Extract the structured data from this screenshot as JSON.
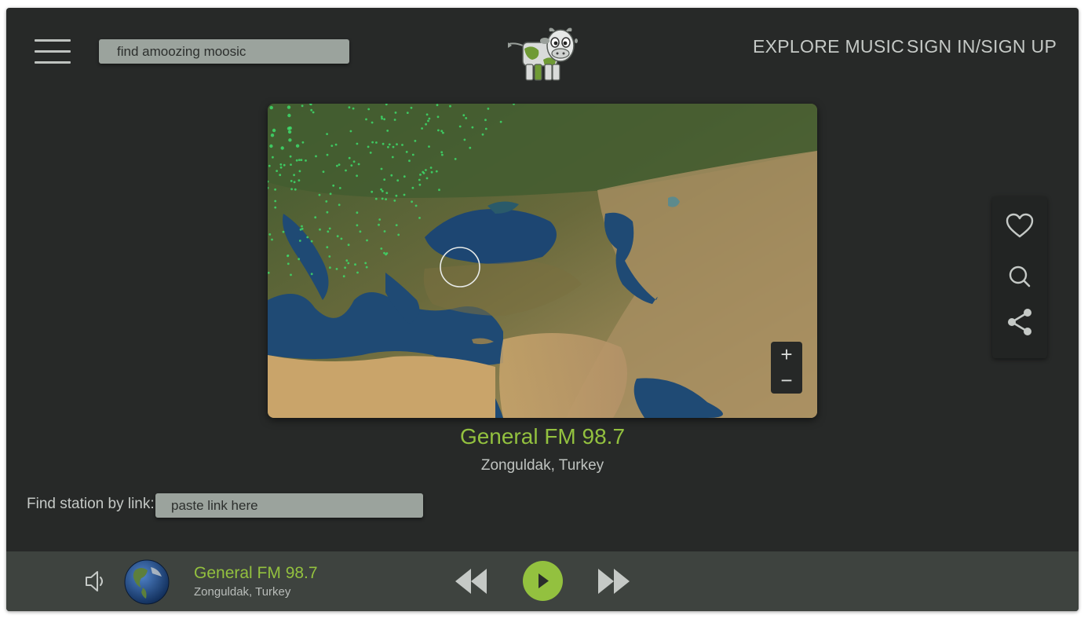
{
  "header": {
    "search_placeholder": "find amoozing moosic",
    "nav": {
      "explore": "EXPLORE MUSIC",
      "sign_in": "SIGN IN/SIGN UP"
    },
    "logo_icon": "cow-logo-icon"
  },
  "map": {
    "zoom_in": "+",
    "zoom_out": "−",
    "station_dot_color": "#3ddb6a"
  },
  "station": {
    "name": "General FM 98.7",
    "location": "Zonguldak, Turkey"
  },
  "side_actions": [
    "heart-icon",
    "search-icon",
    "share-icon"
  ],
  "find_link": {
    "label": "Find station by link:",
    "placeholder": "paste link here"
  },
  "player": {
    "title": "General FM 98.7",
    "location": "Zonguldak, Turkey",
    "controls": [
      "volume-icon",
      "rewind-icon",
      "play-icon",
      "fast-forward-icon"
    ]
  },
  "colors": {
    "accent": "#93c13f",
    "background": "#272928",
    "player_bar": "#3e433f",
    "input": "#9ba39d"
  }
}
